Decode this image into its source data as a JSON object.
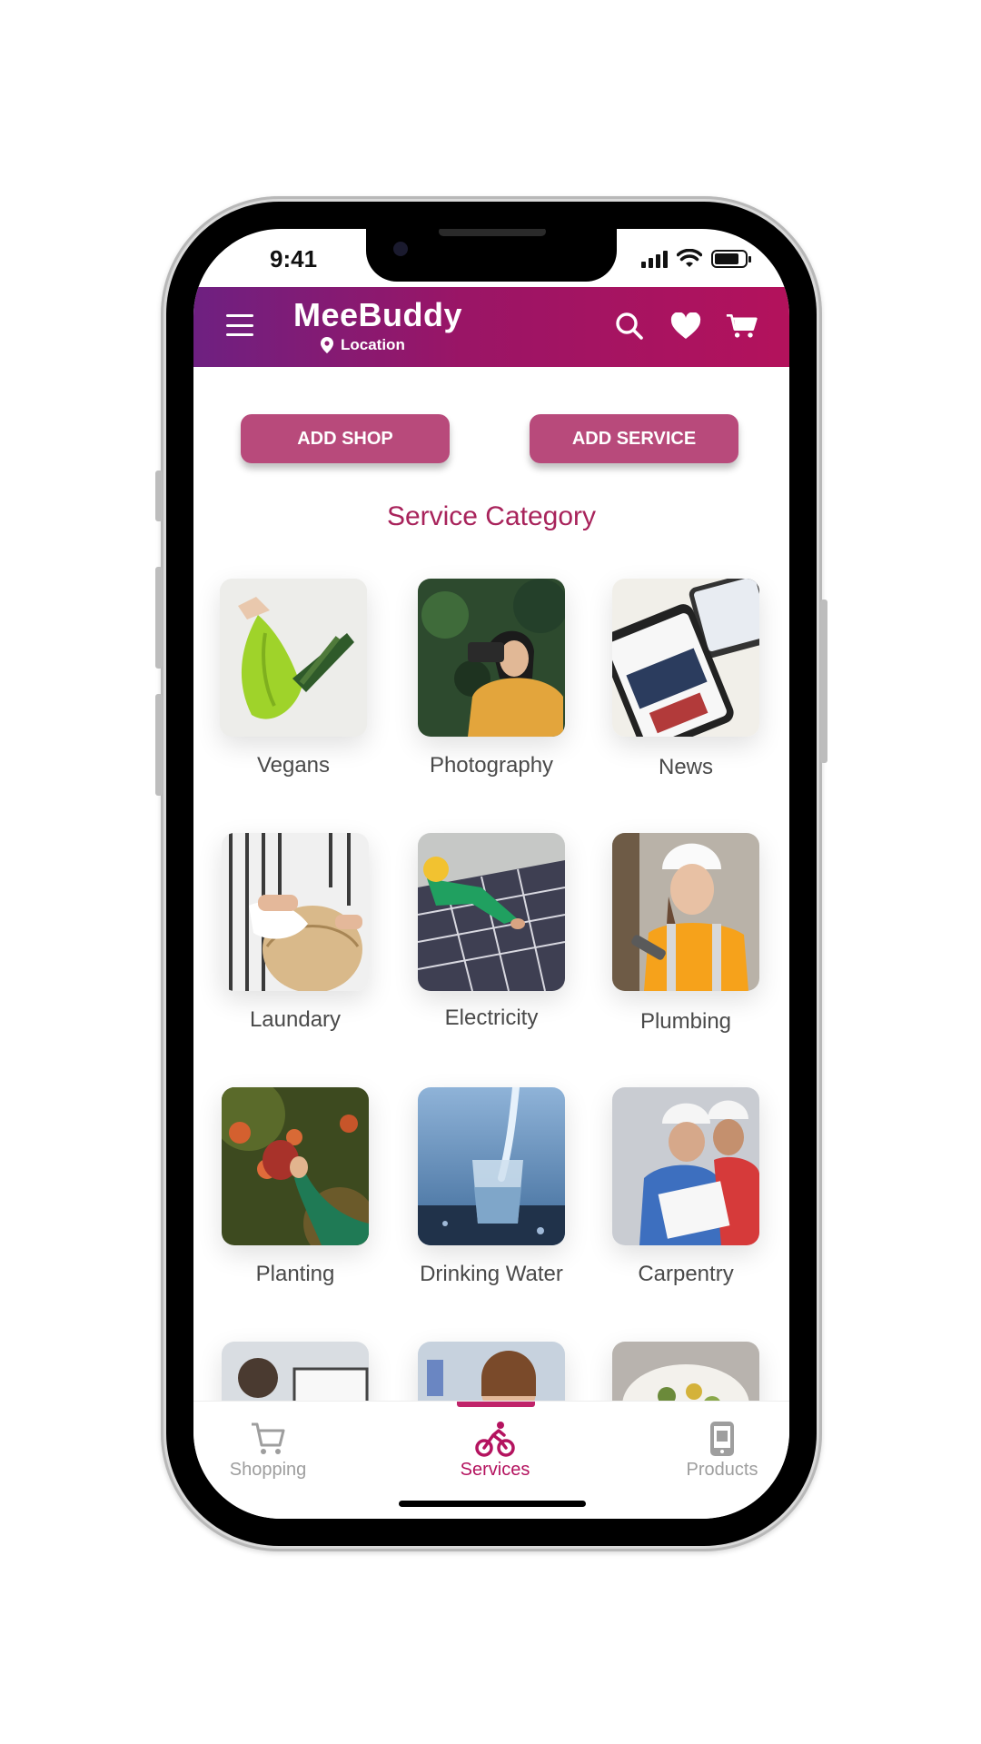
{
  "status_bar": {
    "time": "9:41"
  },
  "header": {
    "brand": "MeeBuddy",
    "location": "Location",
    "gradient": [
      "#6e2081",
      "#b3125c"
    ]
  },
  "actions": {
    "add_shop": "ADD SHOP",
    "add_service": "ADD SERVICE"
  },
  "section_title": "Service Category",
  "categories": [
    {
      "label": "Vegans",
      "icon": "vegans-image"
    },
    {
      "label": "Photography",
      "icon": "photography-image"
    },
    {
      "label": "News",
      "icon": "news-image"
    },
    {
      "label": "Laundary",
      "icon": "laundry-image"
    },
    {
      "label": "Electricity",
      "icon": "electricity-image"
    },
    {
      "label": "Plumbing",
      "icon": "plumbing-image"
    },
    {
      "label": "Planting",
      "icon": "planting-image"
    },
    {
      "label": "Drinking Water",
      "icon": "drinking-water-image"
    },
    {
      "label": "Carpentry",
      "icon": "carpentry-image"
    }
  ],
  "bottom_nav": {
    "items": [
      {
        "label": "Shopping",
        "icon": "cart-icon",
        "active": false
      },
      {
        "label": "Services",
        "icon": "cyclist-icon",
        "active": true
      },
      {
        "label": "Products",
        "icon": "phone-icon",
        "active": false
      }
    ]
  },
  "colors": {
    "accent": "#b4135f",
    "button": "#b84a7b",
    "title": "#a8235b"
  }
}
